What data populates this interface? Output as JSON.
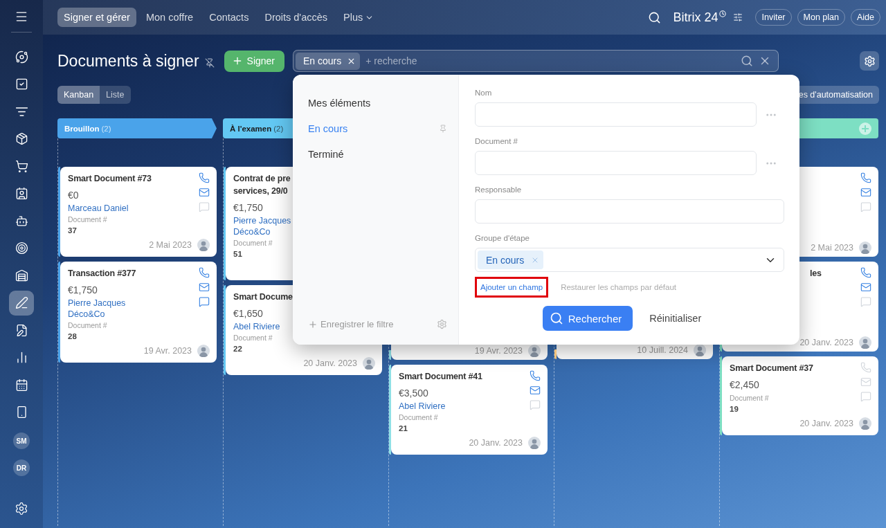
{
  "top_nav": {
    "tabs": [
      {
        "label": "Signer et gérer",
        "selected": true
      },
      {
        "label": "Mon coffre",
        "selected": false
      },
      {
        "label": "Contacts",
        "selected": false
      },
      {
        "label": "Droits d'accès",
        "selected": false
      },
      {
        "label": "Plus",
        "selected": false,
        "dropdown": true
      }
    ],
    "brand": "Bitrix 24",
    "buttons": [
      "Inviter",
      "Mon plan",
      "Aide"
    ]
  },
  "sidebar": {
    "items": [
      {
        "selected": false
      },
      {
        "selected": false
      },
      {
        "selected": false
      },
      {
        "selected": false
      },
      {
        "selected": false
      },
      {
        "selected": false
      },
      {
        "selected": false
      },
      {
        "selected": false
      },
      {
        "selected": false
      },
      {
        "selected": true
      },
      {
        "selected": false
      },
      {
        "selected": false
      },
      {
        "selected": false
      },
      {
        "selected": false
      }
    ],
    "avatars": [
      "SM",
      "DR"
    ]
  },
  "page": {
    "title": "Documents à signer",
    "primary_button": "Signer",
    "search": {
      "chip": "En cours",
      "placeholder": "+ recherche"
    }
  },
  "view_switch": [
    {
      "label": "Kanban",
      "selected": true
    },
    {
      "label": "Liste",
      "selected": false
    }
  ],
  "automation_button": "es d'automatisation",
  "columns": [
    {
      "title": "Brouillon",
      "count": "(2)",
      "color": "#4aa3ea",
      "cards": [
        {
          "kind": "full",
          "title": "Smart Document #73",
          "amount": "€0",
          "contacts": [
            "Marceau Daniel"
          ],
          "field_label": "Document #",
          "field_value": "37",
          "date": "2 Mai 2023",
          "actions": [
            {
              "active": true
            },
            {
              "active": true
            },
            {
              "active": false
            }
          ]
        },
        {
          "kind": "full",
          "title": "Transaction #377",
          "amount": "€1,750",
          "contacts": [
            "Pierre Jacques",
            "Déco&Co"
          ],
          "field_label": "Document #",
          "field_value": "28",
          "date": "19 Avr. 2023",
          "actions": [
            {
              "active": true
            },
            {
              "active": true
            },
            {
              "active": true
            }
          ]
        }
      ]
    },
    {
      "title": "À l'examen",
      "count": "(2)",
      "color": "#63c8f3",
      "cards": [
        {
          "kind": "full",
          "title": "Contrat de pre\nservices, 29/0",
          "amount": "€1,750",
          "contacts": [
            "Pierre Jacques",
            "Déco&Co"
          ],
          "field_label": "Document #",
          "field_value": "51"
        },
        {
          "kind": "full",
          "title": "Smart Docume",
          "amount": "€1,650",
          "contacts": [
            "Abel Riviere"
          ],
          "field_label": "Document #",
          "field_value": "22",
          "date": "20 Janv. 2023"
        }
      ]
    },
    {
      "color": "#8fe0e6",
      "cards": [
        {
          "kind": "partial",
          "date": "19 Avr. 2023"
        },
        {
          "kind": "full",
          "title": "Smart Document #41",
          "amount": "€3,500",
          "contacts": [
            "Abel Riviere"
          ],
          "field_label": "Document #",
          "field_value": "21",
          "date": "20 Janv. 2023",
          "actions": [
            {
              "active": true
            },
            {
              "active": true
            },
            {
              "active": false
            }
          ]
        }
      ]
    },
    {
      "color": "#f2c27a",
      "cards": [
        {
          "kind": "partial",
          "date": "10 Juill. 2024"
        }
      ]
    },
    {
      "color": "#7ddfc3",
      "can_add": true,
      "cards": [
        {
          "kind": "partial",
          "date": "2 Mai 2023",
          "actions": [
            {
              "active": true
            },
            {
              "active": true
            },
            {
              "active": false
            }
          ]
        },
        {
          "kind": "partial",
          "title": "les",
          "date": "20 Janv. 2023",
          "actions": [
            {
              "active": true
            },
            {
              "active": true
            },
            {
              "active": false
            }
          ]
        },
        {
          "kind": "full",
          "title": "Smart Document #37",
          "amount": "€2,450",
          "field_label": "Document #",
          "field_value": "19",
          "date": "20 Janv. 2023",
          "actions": [
            {
              "active": false
            },
            {
              "active": false
            },
            {
              "active": false
            }
          ]
        }
      ]
    }
  ],
  "filter_popup": {
    "presets": [
      {
        "label": "Mes éléments",
        "selected": false,
        "pinned": false
      },
      {
        "label": "En cours",
        "selected": true,
        "pinned": true
      },
      {
        "label": "Terminé",
        "selected": false,
        "pinned": false
      }
    ],
    "save_filter": "Enregistrer le filtre",
    "fields": [
      {
        "label": "Nom",
        "kind": "text",
        "more": true
      },
      {
        "label": "Document #",
        "kind": "text",
        "more": true
      },
      {
        "label": "Responsable",
        "kind": "text",
        "more": false
      },
      {
        "label": "Groupe d'étape",
        "kind": "select",
        "more": false,
        "chips": [
          "En cours"
        ]
      }
    ],
    "links": [
      {
        "label": "Ajouter un champ",
        "highlighted": true
      },
      {
        "label": "Restaurer les champs par défaut",
        "highlighted": false
      }
    ],
    "search_button": "Rechercher",
    "reset_button": "Réinitialiser"
  }
}
